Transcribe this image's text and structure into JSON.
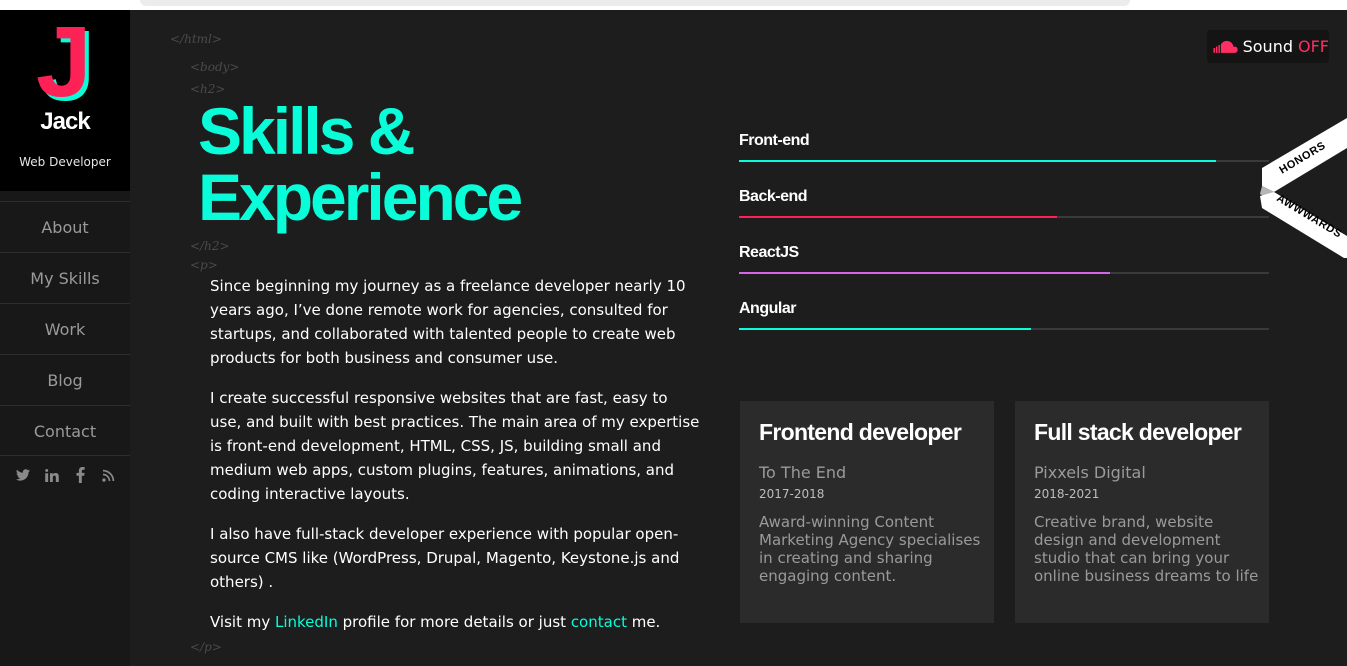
{
  "sidebar": {
    "logo_letter": "J",
    "name": "Jack",
    "role": "Web Developer",
    "nav": [
      {
        "label": "About"
      },
      {
        "label": "My Skills"
      },
      {
        "label": "Work"
      },
      {
        "label": "Blog"
      },
      {
        "label": "Contact"
      }
    ],
    "social_icons": [
      "twitter-icon",
      "linkedin-icon",
      "facebook-icon",
      "rss-icon"
    ]
  },
  "tags": {
    "html_close": "</html>",
    "body_open": "<body>",
    "h2_open": "<h2>",
    "h2_close": "</h2>",
    "p_open": "<p>",
    "p_close": "</p>"
  },
  "heading": {
    "line1": "Skills &",
    "line2": "Experience"
  },
  "paragraphs": {
    "p1": "Since beginning my journey as a freelance developer nearly 10 years ago, I’ve done remote work for agencies, consulted for startups, and collaborated with talented people to create web products for both business and consumer use.",
    "p2": "I create successful responsive websites that are fast, easy to use, and built with best practices. The main area of my expertise is front-end development, HTML, CSS, JS, building small and medium web apps, custom plugins, features, animations, and coding interactive layouts.",
    "p3": "I also have full-stack developer experience with popular open-source CMS like (WordPress, Drupal, Magento, Keystone.js and others) .",
    "p4_before": "Visit my ",
    "p4_link1": "LinkedIn",
    "p4_middle": " profile for more details or just ",
    "p4_link2": "contact",
    "p4_after": " me."
  },
  "skills": [
    {
      "label": "Front-end",
      "level": 0.9,
      "color": "#08fdd8"
    },
    {
      "label": "Back-end",
      "level": 0.6,
      "color": "#fd2155"
    },
    {
      "label": "ReactJS",
      "level": 0.7,
      "color": "#d565e8"
    },
    {
      "label": "Angular",
      "level": 0.55,
      "color": "#08fdd8"
    }
  ],
  "cards": [
    {
      "title": "Frontend developer",
      "company": "To The End",
      "period": "2017-2018",
      "description": "Award-winning Content Marketing Agency specialises in creating and sharing engaging content."
    },
    {
      "title": "Full stack developer",
      "company": "Pixxels Digital",
      "period": "2018-2021",
      "description": "Creative brand, website design and development studio that can bring your online business dreams to life"
    }
  ],
  "sound": {
    "icon": "soundcloud-icon",
    "label": "Sound",
    "state": "OFF"
  },
  "ribbon": {
    "top_text": "HONORS",
    "bottom_text": "AWWWARDS"
  },
  "colors": {
    "accent": "#08fdd8",
    "logo_pink": "#fd2155",
    "background": "#1d1d1d"
  }
}
